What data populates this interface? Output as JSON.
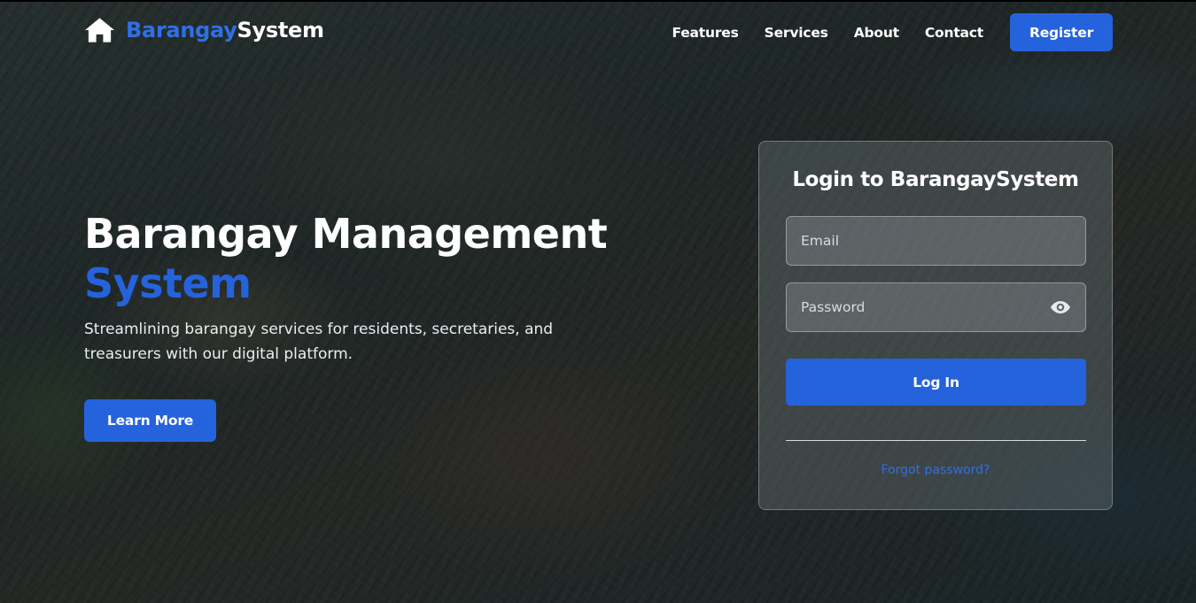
{
  "brand": {
    "icon": "home-icon",
    "name_part1": "Barangay",
    "name_part2": "System",
    "accent_color": "#2f6fe6"
  },
  "nav": {
    "links": [
      "Features",
      "Services",
      "About",
      "Contact"
    ],
    "register_label": "Register"
  },
  "hero": {
    "title_line1": "Barangay Management",
    "title_line2": "System",
    "subtitle": "Streamlining barangay services for residents, secretaries, and treasurers with our digital platform.",
    "cta_label": "Learn More"
  },
  "login": {
    "title": "Login to BarangaySystem",
    "email_placeholder": "Email",
    "password_placeholder": "Password",
    "toggle_icon": "eye-icon",
    "submit_label": "Log In",
    "forgot_label": "Forgot password?"
  },
  "colors": {
    "primary": "#2563dd",
    "link": "#2f6fe6"
  }
}
